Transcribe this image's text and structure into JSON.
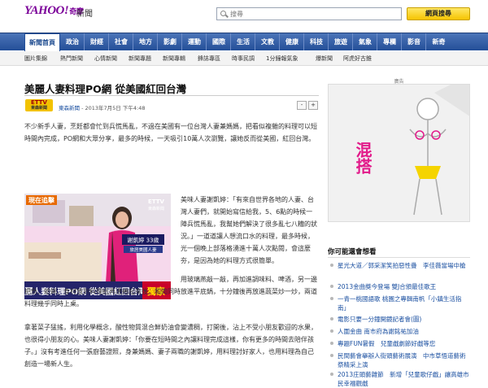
{
  "brand": {
    "logo": "YAHOO!",
    "logo_sub": "奇摩",
    "section": "新聞"
  },
  "search": {
    "placeholder": "搜尋",
    "button": "網頁搜尋"
  },
  "nav": [
    "新聞首頁",
    "政治",
    "財經",
    "社會",
    "地方",
    "影劇",
    "運動",
    "國際",
    "生活",
    "文教",
    "健康",
    "科技",
    "旅遊",
    "氣象",
    "專欄",
    "影音",
    "新奇"
  ],
  "subnav": [
    "圖片集錦",
    "熱門新聞",
    "心情新聞",
    "新聞專題",
    "新聞專輯",
    "鋒誌專區",
    "時事民調",
    "1分鐘報氣象",
    "爆新聞",
    "阿虎好古錐"
  ],
  "article": {
    "title": "美麗人妻料理PO網 從美國紅回台灣",
    "source_badge_top": "ETTV",
    "source_badge_bottom": "東森新聞",
    "source": "東森新聞",
    "date": "2013年7月5日 下午4:48",
    "font_minus": "-",
    "font_plus": "+",
    "p1": "不少新手人妻，烹飪都會忙到兵慌馬亂，不過在美國有一位台灣人妻兼媽媽，把看似複雜的料理可以短時間內完成，PO網和大眾分享，最多的時候，一天吸引10萬人次瀏覽，讓她反而從美國，紅回台灣。",
    "p2": "美味人妻謝凱婷：「有來自世界各地的人妻、台灣人妻們，就開始寫信給我，5、6點的時候一陣兵慌馬亂，我幫她們解決了很多亂七八糟的狀況。」一道道讓人想流口水的料理，最多時候，光一個晚上部落格湧進十萬人次點閱，會這麼夯，是因為她的料理方式很簡單。",
    "p3": "用玻璃燕敲一敲，再加進調味料、啤酒，另一邊把魚、蛤蜊、食材放到料理紙再通捲起來後，和肉同時放進平底鍋，十分鐘後再放進蔬菜炒一炒，兩道料理幾乎同時上桌。",
    "p4": "拿著菜子猛搖，利用化學概念，酸性物質混合鮮奶油會變濃稠，打開後，沾上不受小朋友歡迎的水果，也很得小朋友的心。美味人妻謝凱婷：「你要在短時間之內讓料理完成這樣，你有更多的時間去陪伴孩子。」沒有考進任何一張廚藝證照，身兼媽媽、妻子兩職的謝凱婷，用料理討好家人，也用料理為自己創造一場新人生。"
  },
  "photo": {
    "corner_tag": "現在追擊",
    "channel": "ETTV",
    "channel_sub": "東森新聞",
    "nameplate": "謝凱婷 33歲",
    "nameplate_sub": "旅居美國人妻",
    "caption": "美麗人妻料理PO網 從美國紅回台灣",
    "ribbon": "獨家"
  },
  "ad": {
    "label": "廣告",
    "text": "混搭"
  },
  "sidebar": {
    "heading": "你可能還會想看",
    "items": [
      "星光大道／郭采潔笑拍惡性疊　李佳薇當場中槍",
      "2013金曲獎今登場 雙J合頒最佳歌王",
      "一青一桃國語歌 桃園之專輯南帆「小鎮生活指南」",
      "電影只要一分鐘開鏡記者會(圖)",
      "人圍金曲 南市府為謝銘祐加油",
      "專題FUN暑假　兒童戲劇節好戲等您",
      "民間藝會舉辦人街頭藝術展演　中市草悟道藝術祭精采上演",
      "2013庄頭藝雜節　新增「兒童歌仔戲」讓高雄市民幸福觀戲"
    ]
  },
  "colors": {
    "nav_bg": "#2f5ba6",
    "link": "#1a4fa0",
    "search_button": "#f5c400",
    "logo": "#7b0099"
  }
}
